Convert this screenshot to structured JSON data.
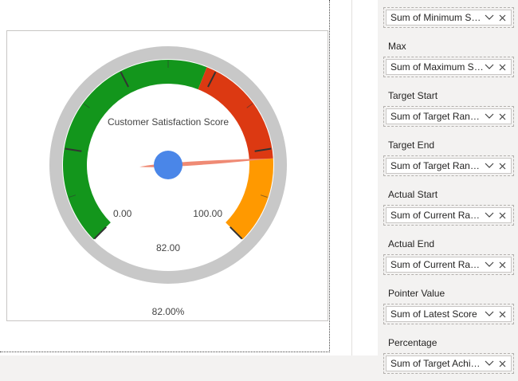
{
  "gauge": {
    "title": "Customer Satisfaction Score",
    "min_label": "0.00",
    "max_label": "100.00",
    "value_label": "82.00",
    "percentage_label": "82.00%",
    "min": 0,
    "max": 100,
    "target_start": 58,
    "target_end": 82,
    "actual_start": 82,
    "actual_end": 100,
    "pointer_value": 82,
    "colors": {
      "outer_ring": "#c8c8c8",
      "band_low": "#13961c",
      "band_target": "#dc3912",
      "band_actual": "#ff9900",
      "pointer": "#ef8a74",
      "hub": "#4a86e8",
      "ticks": "#333333"
    }
  },
  "pane": {
    "fields": [
      {
        "label": "",
        "value": "Sum of Minimum Score"
      },
      {
        "label": "Max",
        "value": "Sum of Maximum Score"
      },
      {
        "label": "Target Start",
        "value": "Sum of Target Range Start"
      },
      {
        "label": "Target End",
        "value": "Sum of Target Range End"
      },
      {
        "label": "Actual Start",
        "value": "Sum of Current Range Start"
      },
      {
        "label": "Actual End",
        "value": "Sum of Current Range End"
      },
      {
        "label": "Pointer Value",
        "value": "Sum of Latest Score"
      },
      {
        "label": "Percentage",
        "value": "Sum of Target Achievement"
      }
    ],
    "icons": {
      "expand": "chevron-down-icon",
      "remove": "close-icon"
    }
  }
}
